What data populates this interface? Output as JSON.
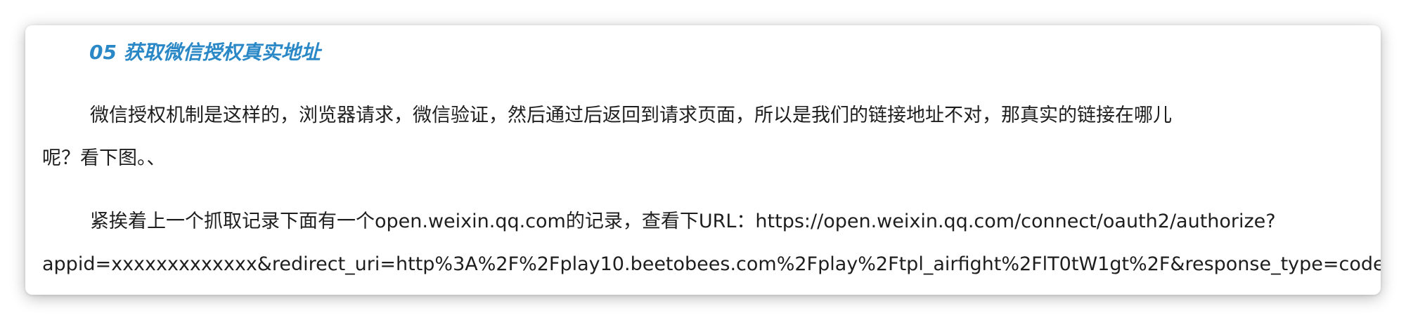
{
  "article": {
    "heading": "05 获取微信授权真实地址",
    "paragraph1": {
      "line1": "微信授权机制是这样的，浏览器请求，微信验证，然后通过后返回到请求页面，所以是我们的链接地址不对，那真实的链接在哪儿",
      "line2": "呢？看下图。、"
    },
    "paragraph2": {
      "line1": "紧挨着上一个抓取记录下面有一个open.weixin.qq.com的记录，查看下URL：https://open.weixin.qq.com/connect/oauth2/authorize?",
      "line2": "appid=xxxxxxxxxxxxx&redirect_uri=http%3A%2F%2Fplay10.beetobees.com%2Fplay%2Ftpl_airfight%2FlT0tW1gt%2F&response_type=code&s"
    }
  },
  "colors": {
    "heading": "#2b88c6",
    "body_text": "#1e1e1e",
    "background": "#ffffff"
  }
}
